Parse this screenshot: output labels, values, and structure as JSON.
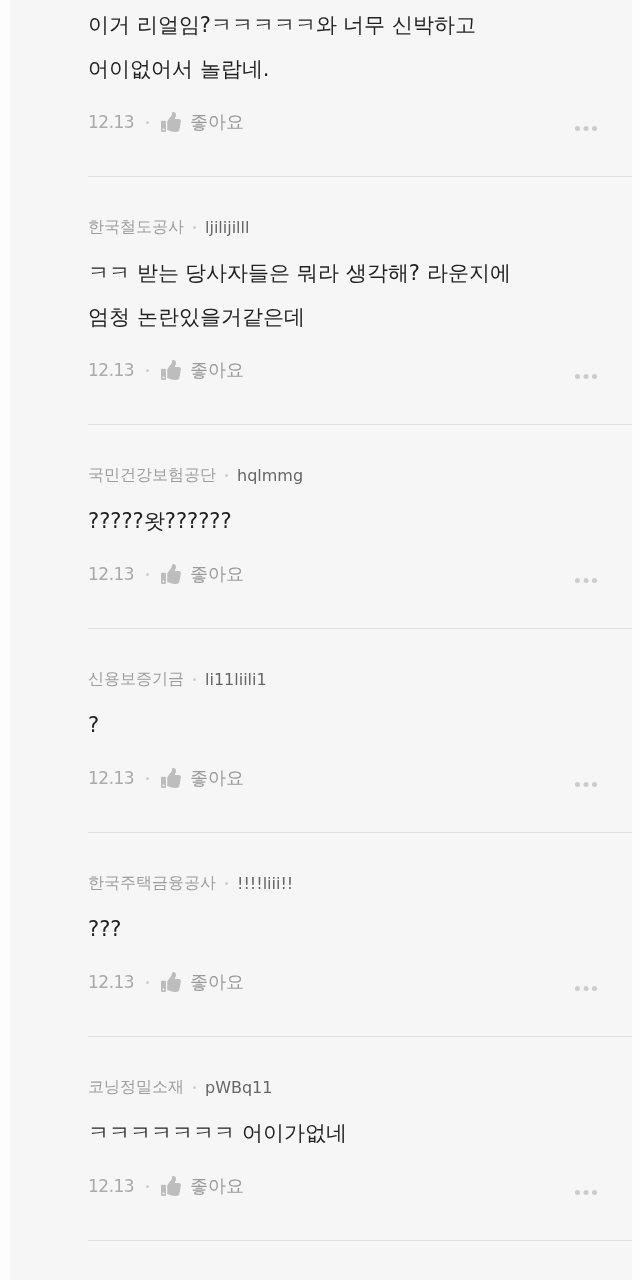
{
  "comments": [
    {
      "lines": [
        "이거 리얼임?ㅋㅋㅋㅋㅋ와 너무 신박하고",
        "어이없어서 놀랍네."
      ],
      "date": "12.13",
      "like_label": "좋아요"
    },
    {
      "author": {
        "organization": "한국철도공사",
        "username": "ljilijilll"
      },
      "lines": [
        "ㅋㅋ 받는 당사자들은 뭐라 생각해? 라운지에",
        "엄청 논란있을거같은데"
      ],
      "date": "12.13",
      "like_label": "좋아요"
    },
    {
      "author": {
        "organization": "국민건강보험공단",
        "username": "hqlmmg"
      },
      "lines": [
        "?????왓??????"
      ],
      "date": "12.13",
      "like_label": "좋아요"
    },
    {
      "author": {
        "organization": "신용보증기금",
        "username": "li11liili1"
      },
      "lines": [
        "?"
      ],
      "date": "12.13",
      "like_label": "좋아요"
    },
    {
      "author": {
        "organization": "한국주택금융공사",
        "username": "!!!!liii!!"
      },
      "lines": [
        "???"
      ],
      "date": "12.13",
      "like_label": "좋아요"
    },
    {
      "author": {
        "organization": "코닝정밀소재",
        "username": "pWBq11"
      },
      "lines": [
        "ㅋㅋㅋㅋㅋㅋㅋ 어이가없네"
      ],
      "date": "12.13",
      "like_label": "좋아요"
    }
  ]
}
